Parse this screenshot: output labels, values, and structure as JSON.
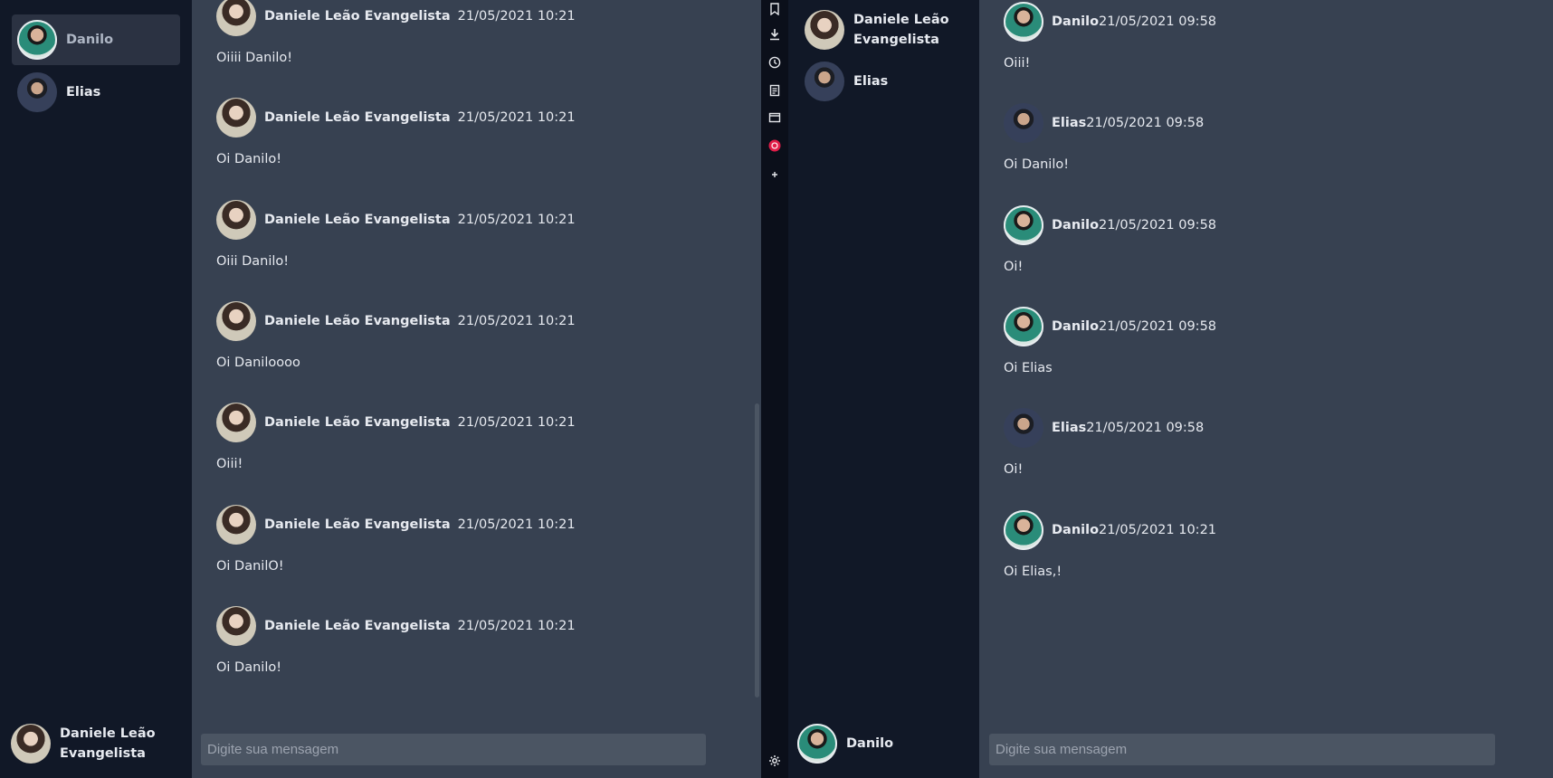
{
  "left_app": {
    "contacts": [
      {
        "name": "Danilo",
        "active": true
      },
      {
        "name": "Elias",
        "active": false
      }
    ],
    "current_user": {
      "name_line1": "Daniele Leão",
      "name_line2": "Evangelista"
    },
    "messages": [
      {
        "author": "Daniele Leão Evangelista",
        "time": "21/05/2021 10:21",
        "text": "Oiiii Danilo!"
      },
      {
        "author": "Daniele Leão Evangelista",
        "time": "21/05/2021 10:21",
        "text": "Oi Danilo!"
      },
      {
        "author": "Daniele Leão Evangelista",
        "time": "21/05/2021 10:21",
        "text": "Oiii Danilo!"
      },
      {
        "author": "Daniele Leão Evangelista",
        "time": "21/05/2021 10:21",
        "text": "Oi Daniloooo"
      },
      {
        "author": "Daniele Leão Evangelista",
        "time": "21/05/2021 10:21",
        "text": "Oiii!"
      },
      {
        "author": "Daniele Leão Evangelista",
        "time": "21/05/2021 10:21",
        "text": "Oi DanilO!"
      },
      {
        "author": "Daniele Leão Evangelista",
        "time": "21/05/2021 10:21",
        "text": "Oi Danilo!"
      }
    ],
    "composer_placeholder": "Digite sua mensagem"
  },
  "rail": {
    "icons": [
      "bookmark-icon",
      "download-icon",
      "history-icon",
      "notes-icon",
      "window-icon",
      "extension-icon",
      "add-icon",
      "settings-icon"
    ]
  },
  "right_app": {
    "contacts": [
      {
        "name_line1": "Daniele Leão",
        "name_line2": "Evangelista"
      },
      {
        "name_line1": "Elias",
        "name_line2": ""
      }
    ],
    "current_user": {
      "name": "Danilo"
    },
    "messages": [
      {
        "author": "Danilo",
        "time": "21/05/2021 09:58",
        "text": "Oiii!"
      },
      {
        "author": "Elias",
        "time": "21/05/2021 09:58",
        "text": "Oi Danilo!"
      },
      {
        "author": "Danilo",
        "time": "21/05/2021 09:58",
        "text": "Oi!"
      },
      {
        "author": "Danilo",
        "time": "21/05/2021 09:58",
        "text": "Oi Elias"
      },
      {
        "author": "Elias",
        "time": "21/05/2021 09:58",
        "text": "Oi!"
      },
      {
        "author": "Danilo",
        "time": "21/05/2021 10:21",
        "text": "Oi Elias,!"
      }
    ],
    "composer_placeholder": "Digite sua mensagem"
  },
  "colors": {
    "sidebar_bg": "#111827",
    "chat_bg": "#374151",
    "input_bg": "#4b5563",
    "active_contact_bg": "#2b3242",
    "extension_accent": "#e11d48"
  }
}
